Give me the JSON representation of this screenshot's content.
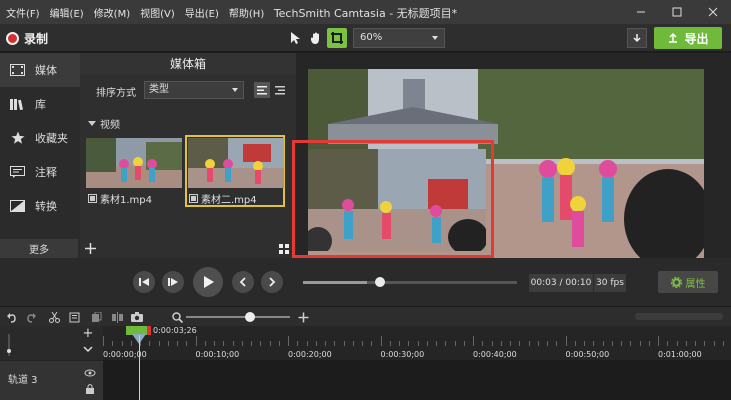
{
  "menu": [
    "文件(F)",
    "编辑(E)",
    "修改(M)",
    "视图(V)",
    "导出(E)",
    "帮助(H)"
  ],
  "app_title": "TechSmith Camtasia - 无标题项目*",
  "toolbar": {
    "record_label": "录制",
    "zoom_value": "60%",
    "export_label": "导出"
  },
  "sidenav": {
    "items": [
      {
        "label": "媒体",
        "icon": "film-icon"
      },
      {
        "label": "库",
        "icon": "library-icon"
      },
      {
        "label": "收藏夹",
        "icon": "star-icon"
      },
      {
        "label": "注释",
        "icon": "annotation-icon"
      },
      {
        "label": "转换",
        "icon": "transition-icon"
      }
    ],
    "more_label": "更多"
  },
  "mediabin": {
    "title": "媒体箱",
    "sort_label": "排序方式",
    "sort_value": "类型",
    "section_label": "视频",
    "items": [
      {
        "label": "素材1.mp4"
      },
      {
        "label": "素材二.mp4"
      }
    ]
  },
  "playback": {
    "time_display": "00:03 / 00:10",
    "fps": "30 fps",
    "properties_label": "属性",
    "progress_fraction": 0.3
  },
  "timeline": {
    "playhead_time": "0:00:03;26",
    "ticks": [
      "0:00:00;00",
      "0:00:10;00",
      "0:00:20;00",
      "0:00:30;00",
      "0:00:40;00",
      "0:00:50;00",
      "0:01:00;00"
    ],
    "track_name": "轨道 3",
    "zoom_fraction": 0.6
  },
  "colors": {
    "accent_green": "#6fba3a",
    "record_red": "#d32f2f",
    "selection_red": "#e53935",
    "thumb_selected": "#e3c23b"
  }
}
